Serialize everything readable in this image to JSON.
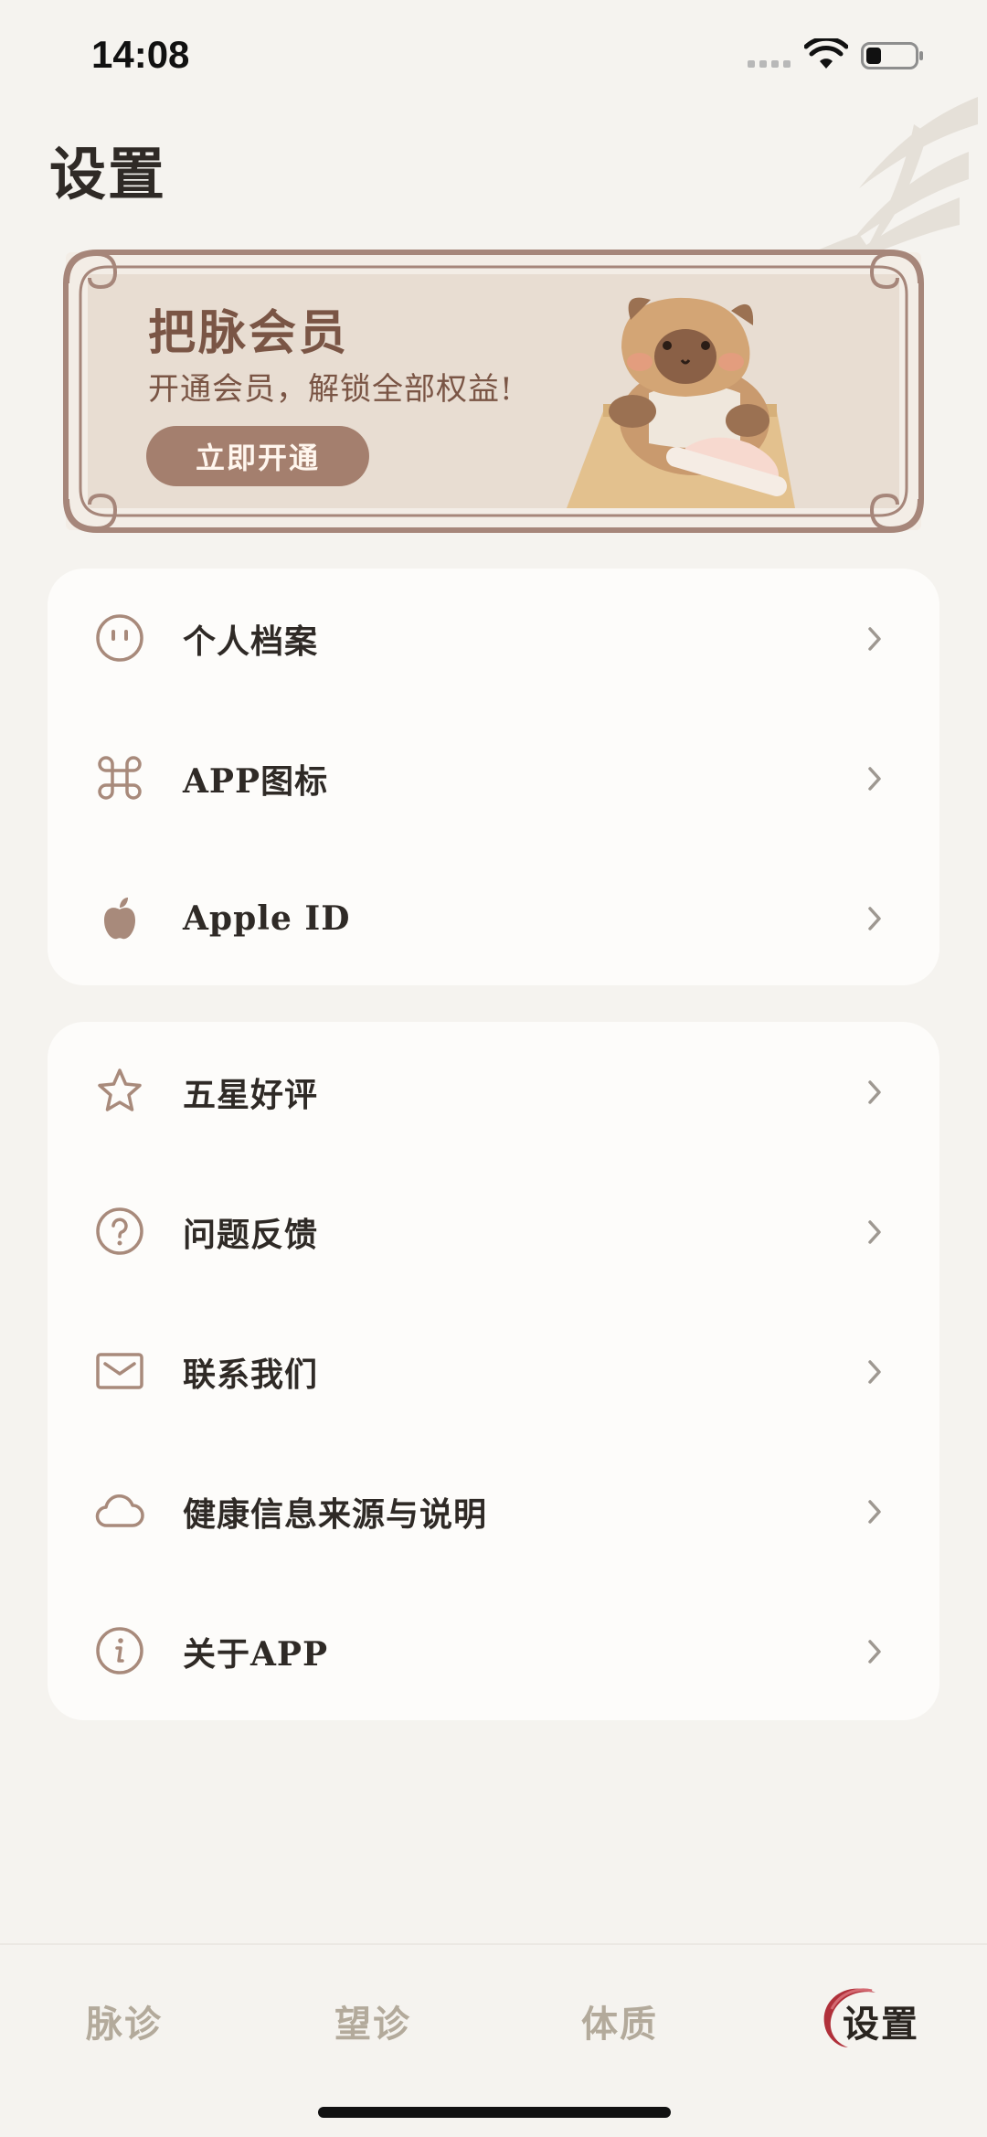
{
  "status_bar": {
    "time": "14:08"
  },
  "page": {
    "title": "设置"
  },
  "member_banner": {
    "title": "把脉会员",
    "subtitle": "开通会员，解锁全部权益!",
    "button_label": "立即开通"
  },
  "settings_group_1": {
    "items": [
      {
        "label": "个人档案",
        "icon": "face-icon"
      },
      {
        "label": "APP图标",
        "icon": "command-icon"
      },
      {
        "label": "Apple ID",
        "icon": "apple-icon"
      }
    ]
  },
  "settings_group_2": {
    "items": [
      {
        "label": "五星好评",
        "icon": "star-icon"
      },
      {
        "label": "问题反馈",
        "icon": "question-icon"
      },
      {
        "label": "联系我们",
        "icon": "mail-icon"
      },
      {
        "label": "健康信息来源与说明",
        "icon": "cloud-icon"
      },
      {
        "label": "关于APP",
        "icon": "info-icon"
      }
    ]
  },
  "tab_bar": {
    "tabs": [
      {
        "label": "脉诊",
        "active": false
      },
      {
        "label": "望诊",
        "active": false
      },
      {
        "label": "体质",
        "active": false
      },
      {
        "label": "设置",
        "active": true
      }
    ]
  },
  "colors": {
    "background": "#f5f3ef",
    "card": "#fdfcfa",
    "accent": "#a47f6e",
    "icon": "#a88a7b",
    "text": "#2f2a26",
    "tab_inactive": "#b3aa9b"
  }
}
